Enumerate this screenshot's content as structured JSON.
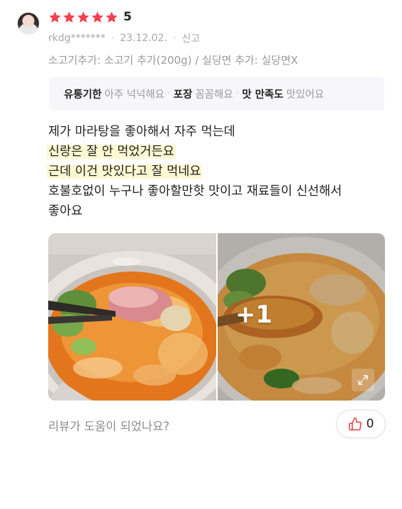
{
  "review": {
    "rating": 5,
    "rating_label": "5",
    "username": "rkdg*******",
    "date": "23.12.02.",
    "report_label": "신고",
    "options": "소고기추가: 소고기 추가(200g) / 실당면 추가: 실당면X",
    "attributes": [
      {
        "key": "유통기한",
        "value": "아주 넉넉해요"
      },
      {
        "key": "포장",
        "value": "꼼꼼해요"
      },
      {
        "key": "맛 만족도",
        "value": "맛있어요"
      }
    ],
    "text_lines": [
      "제가 마라탕을 좋아해서 자주 먹는데",
      "신랑은 잘 안 먹었거든요",
      "근데 이건 맛있다고 잘 먹네요",
      "호불호없이 누구나 좋아할만핫 맛이고 재료들이 신선해서",
      "좋아요"
    ],
    "extra_photo_count": "+1",
    "helpful_question": "리뷰가 도움이 되었나요?",
    "like_count": "0"
  },
  "colors": {
    "star": "#f2424f",
    "highlight": "#fdf8d2",
    "like_icon": "#e8393f"
  },
  "icons": {
    "avatar": "user-avatar",
    "star": "star-icon",
    "expand": "expand-icon",
    "like": "thumbs-up-icon"
  }
}
